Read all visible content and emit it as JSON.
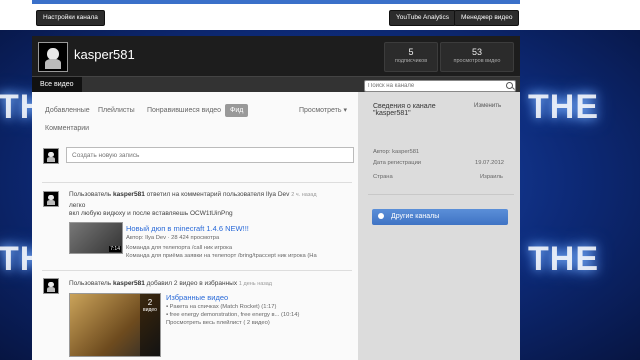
{
  "background": {
    "text": "THE"
  },
  "topbar": {
    "settings_btn": "Настройки канала",
    "analytics_btn": "YouTube Analytics",
    "manager_btn": "Менеджер видео"
  },
  "channel": {
    "name": "kasper581",
    "stats": [
      {
        "value": "5",
        "label": "подписчиков"
      },
      {
        "value": "53",
        "label": "просмотров видео"
      }
    ]
  },
  "nav": {
    "all_videos": "Все видео",
    "search_placeholder": "Поиск на канале"
  },
  "subtabs": {
    "added": "Добавленные",
    "playlists": "Плейлисты",
    "liked": "Понравившиеся видео",
    "feed": "Фид",
    "view": "Просмотреть",
    "comments": "Комментарии"
  },
  "post": {
    "placeholder": "Создать новую запись"
  },
  "feed": [
    {
      "prefix": "Пользователь",
      "user": "kasper581",
      "action": "ответил на комментарий пользователя Ilya Dev",
      "time": "2 ч. назад",
      "text1": "легко",
      "text2": "вкл любую видюху и после вставляешь OCW1tUinPng",
      "video_title": "Новый дюп в minecraft 1.4.6 NEW!!!",
      "video_meta": "Автор: Ilya Dev · 28 424 просмотра",
      "video_desc1": "Команда для телепорта /call ник игрока",
      "video_desc2": "Команда для приёма заявки на телепорт /bring/tpaccept ник игрока (На",
      "duration": "7:14"
    },
    {
      "prefix": "Пользователь",
      "user": "kasper581",
      "action": "добавил 2 видео в избранных",
      "time": "1 день назад",
      "list_title": "Избранные видео",
      "items": [
        "▪ Ракета на спичках (Match Rocket)  (1:17)",
        "▪ free energy demonstration, free energy в...  (10:14)"
      ],
      "view_all": "Просмотреть весь плейлист ( 2 видео)",
      "badge_count": "2",
      "badge_label": "видео"
    }
  ],
  "sidebar": {
    "title": "Сведения о канале \"kasper581\"",
    "edit": "Изменить",
    "author": "Автор: kasper581",
    "reg_label": "Дата регистрации",
    "reg_value": "19.07.2012",
    "country_label": "Страна",
    "country_value": "Израиль",
    "other_channels": "Другие каналы"
  }
}
